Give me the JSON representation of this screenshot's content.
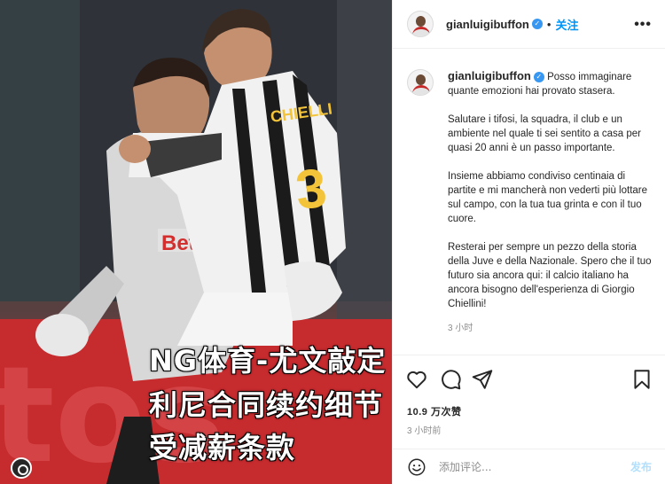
{
  "photo": {
    "overlay_lines": [
      "NG体育-尤文敲定",
      "利尼合同续约细节",
      "受减薪条款"
    ],
    "jersey_sponsor": "Betcl",
    "jersey_name": "CHIELLI",
    "jersey_number": "3",
    "colors": {
      "red_board": "#c92b2f",
      "keeper_kit": "#dcdcdc",
      "juve_stripe": "#1b1b1b"
    }
  },
  "header": {
    "username": "gianluigibuffon",
    "verified_icon": "verified-badge-icon",
    "separator": "•",
    "follow_label": "关注",
    "more_label": "•••"
  },
  "caption": {
    "username": "gianluigibuffon",
    "first_text": "Posso immaginare quante emozioni hai provato stasera.",
    "paragraphs": [
      "Salutare i tifosi, la squadra, il club e un ambiente nel quale ti sei sentito a casa per quasi 20 anni è un passo importante.",
      "Insieme abbiamo condiviso centinaia di partite e mi mancherà non vederti più lottare sul campo, con la tua tua grinta e con il tuo cuore.",
      "Resterai per sempre un pezzo della storia della Juve e della Nazionale. Spero che il tuo futuro sia ancora qui: il calcio italiano ha ancora bisogno dell'esperienza di Giorgio Chiellini!"
    ],
    "time": "3 小时"
  },
  "actions": {
    "icons": [
      "heart-icon",
      "comment-icon",
      "share-icon",
      "bookmark-icon"
    ]
  },
  "likes_text": "10.9 万次赞",
  "post_time": "3 小时前",
  "comment_bar": {
    "placeholder": "添加评论...",
    "post_label": "发布"
  },
  "accent_colors": {
    "link_blue": "#0095f6",
    "verified_blue": "#3897f0",
    "post_disabled": "#b2dffc"
  }
}
